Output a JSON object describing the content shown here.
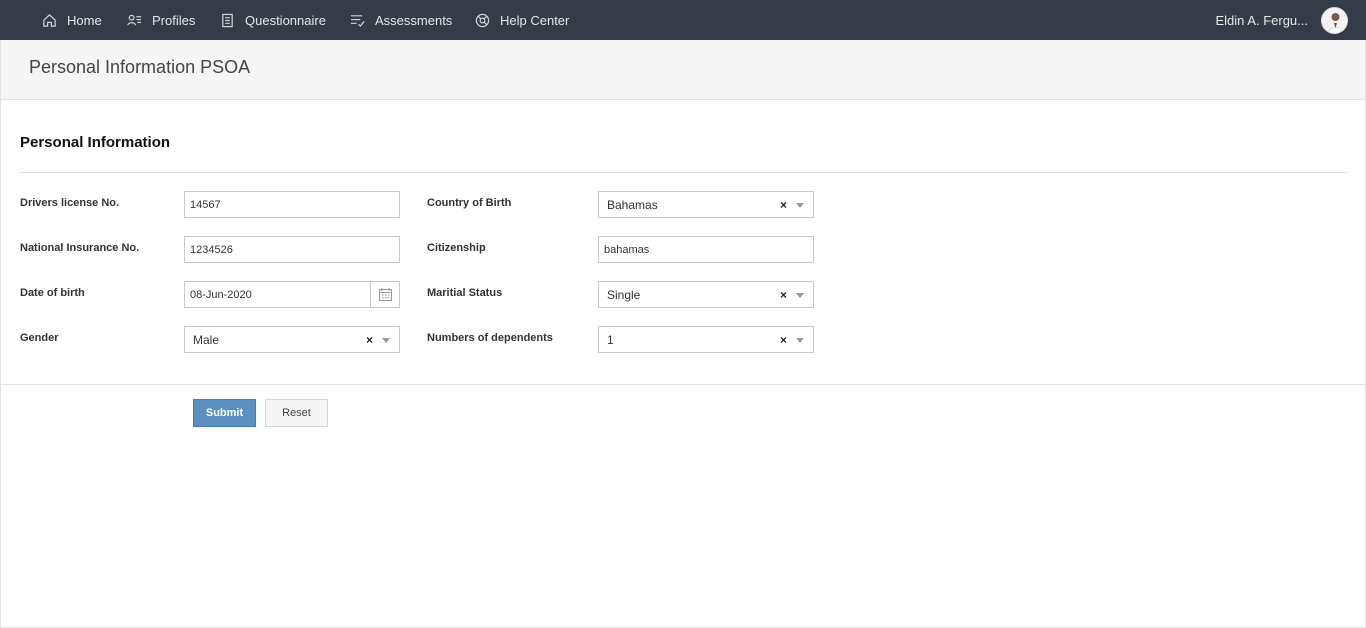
{
  "nav": {
    "items": [
      {
        "label": "Home",
        "icon": "home-icon"
      },
      {
        "label": "Profiles",
        "icon": "profiles-icon"
      },
      {
        "label": "Questionnaire",
        "icon": "questionnaire-icon"
      },
      {
        "label": "Assessments",
        "icon": "assessments-icon"
      },
      {
        "label": "Help Center",
        "icon": "help-icon"
      }
    ],
    "user_name": "Eldin A. Fergu..."
  },
  "page": {
    "title": "Personal Information PSOA",
    "section_title": "Personal Information"
  },
  "form": {
    "drivers_license": {
      "label": "Drivers license No.",
      "value": "14567"
    },
    "national_insurance": {
      "label": "National Insurance No.",
      "value": "1234526"
    },
    "date_of_birth": {
      "label": "Date of birth",
      "value": "08-Jun-2020"
    },
    "gender": {
      "label": "Gender",
      "value": "Male"
    },
    "country_of_birth": {
      "label": "Country of Birth",
      "value": "Bahamas"
    },
    "citizenship": {
      "label": "Citizenship",
      "value": "bahamas"
    },
    "marital_status": {
      "label": "Maritial Status",
      "value": "Single"
    },
    "dependents": {
      "label": "Numbers of dependents",
      "value": "1"
    },
    "clear_symbol": "×"
  },
  "buttons": {
    "submit": "Submit",
    "reset": "Reset"
  },
  "colors": {
    "topbar": "#353c48",
    "primary_button": "#5b8fc0"
  }
}
